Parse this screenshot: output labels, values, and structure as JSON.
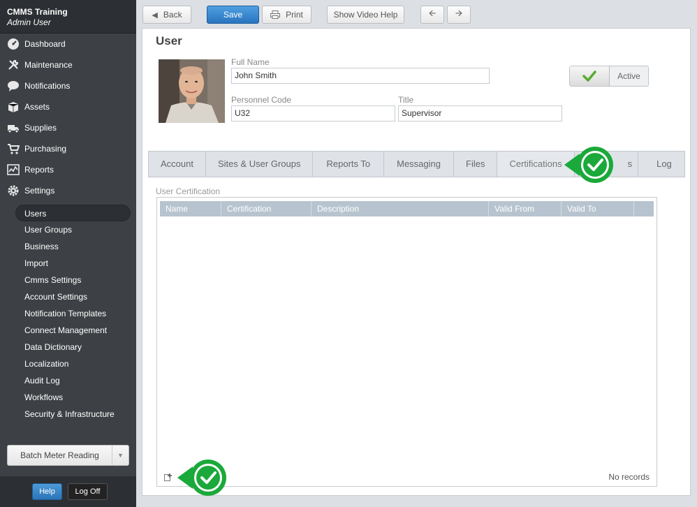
{
  "sidebar": {
    "org": "CMMS Training",
    "user": "Admin User",
    "nav": [
      {
        "label": "Dashboard",
        "icon": "dashboard-icon"
      },
      {
        "label": "Maintenance",
        "icon": "wrench-icon"
      },
      {
        "label": "Notifications",
        "icon": "chat-bubble-icon"
      },
      {
        "label": "Assets",
        "icon": "box-icon"
      },
      {
        "label": "Supplies",
        "icon": "truck-icon"
      },
      {
        "label": "Purchasing",
        "icon": "cart-icon"
      },
      {
        "label": "Reports",
        "icon": "chart-icon"
      },
      {
        "label": "Settings",
        "icon": "gear-icon"
      }
    ],
    "sub": [
      "Users",
      "User Groups",
      "Business",
      "Import",
      "Cmms Settings",
      "Account Settings",
      "Notification Templates",
      "Connect Management",
      "Data Dictionary",
      "Localization",
      "Audit Log",
      "Workflows",
      "Security & Infrastructure"
    ],
    "batch_label": "Batch Meter Reading",
    "help_label": "Help",
    "logoff_label": "Log Off"
  },
  "toolbar": {
    "back": "Back",
    "save": "Save",
    "print": "Print",
    "video_help": "Show Video Help"
  },
  "form": {
    "title": "User",
    "full_name_label": "Full Name",
    "full_name": "John Smith",
    "personnel_code_label": "Personnel Code",
    "personnel_code": "U32",
    "title_label": "Title",
    "title_value": "Supervisor",
    "active_label": "Active"
  },
  "tabs": [
    "Account",
    "Sites & User Groups",
    "Reports To",
    "Messaging",
    "Files",
    "Certifications",
    "s",
    "Log"
  ],
  "active_tab": "Certifications",
  "grid": {
    "section": "User Certification",
    "columns": [
      "Name",
      "Certification",
      "Description",
      "Valid From",
      "Valid To"
    ],
    "empty_text": "No records"
  },
  "colors": {
    "accent": "#2a74bf",
    "callout_green": "#1aa93a",
    "grid_header": "#b7c4cf",
    "sidebar_bg": "#3d4145"
  }
}
